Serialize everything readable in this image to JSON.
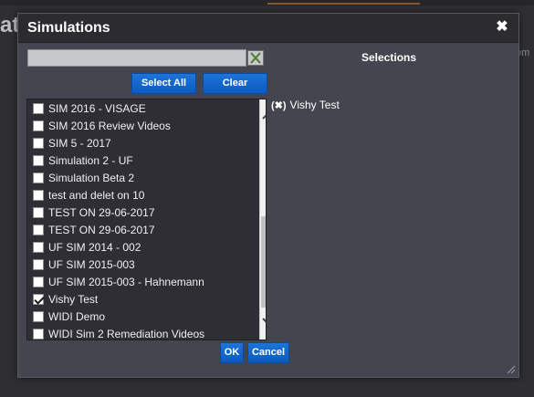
{
  "background": {
    "title_fragment": "ati",
    "right_fragment": "om"
  },
  "dialog": {
    "title": "Simulations",
    "close_glyph": "✖",
    "search": {
      "value": "",
      "placeholder": ""
    },
    "buttons": {
      "select_all": "Select All",
      "clear": "Clear",
      "ok": "OK",
      "cancel": "Cancel"
    },
    "list_items": [
      {
        "label": "SIM 2016 - VISAGE",
        "checked": false
      },
      {
        "label": "SIM 2016 Review Videos",
        "checked": false
      },
      {
        "label": "SIM 5 - 2017",
        "checked": false
      },
      {
        "label": "Simulation 2 - UF",
        "checked": false
      },
      {
        "label": "Simulation Beta 2",
        "checked": false
      },
      {
        "label": "test and delet on 10",
        "checked": false
      },
      {
        "label": "TEST ON 29-06-2017",
        "checked": false
      },
      {
        "label": "TEST ON 29-06-2017",
        "checked": false
      },
      {
        "label": "UF SIM 2014 - 002",
        "checked": false
      },
      {
        "label": "UF SIM 2015-003",
        "checked": false
      },
      {
        "label": "UF SIM 2015-003 - Hahnemann",
        "checked": false
      },
      {
        "label": "Vishy Test",
        "checked": true
      },
      {
        "label": "WIDI Demo",
        "checked": false
      },
      {
        "label": "WIDI Sim 2 Remediation Videos",
        "checked": false
      }
    ],
    "selections_heading": "Selections",
    "selections": [
      {
        "remove_glyph": "(✖)",
        "label": "Vishy Test"
      }
    ]
  },
  "colors": {
    "button_blue": "#0a5bc0",
    "dialog_bg": "#45454f",
    "header_bg": "#2b2b30",
    "list_bg": "#2e2e34"
  },
  "icons": [
    "close-icon",
    "clear-search-icon",
    "scroll-up-icon",
    "scroll-down-icon",
    "checkmark-icon",
    "remove-icon",
    "resize-grip-icon"
  ]
}
